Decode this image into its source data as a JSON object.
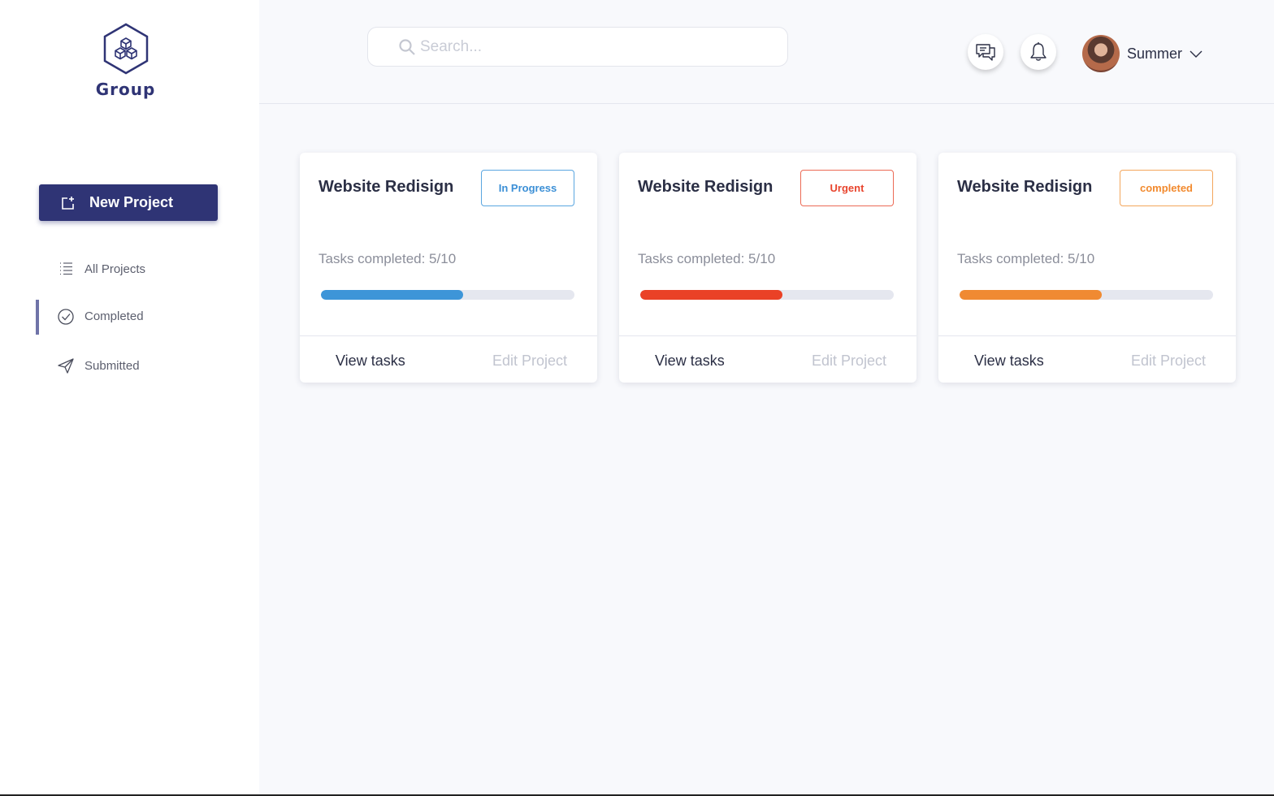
{
  "brand": {
    "name": "Group"
  },
  "sidebar": {
    "new_project_label": "New Project",
    "items": [
      {
        "label": "All Projects",
        "icon": "list-icon",
        "active": false
      },
      {
        "label": "Completed",
        "icon": "check-circle-icon",
        "active": true
      },
      {
        "label": "Submitted",
        "icon": "send-icon",
        "active": false
      }
    ]
  },
  "header": {
    "search_placeholder": "Search...",
    "user_name": "Summer"
  },
  "projects": [
    {
      "title": "Website Redisign",
      "status": "In Progress",
      "status_color": "#3b8fd6",
      "tasks_label": "Tasks completed: 5/10",
      "progress": 0.5,
      "bar_color": "#3d95d8",
      "view_label": "View tasks",
      "edit_label": "Edit Project"
    },
    {
      "title": "Website Redisign",
      "status": "Urgent",
      "status_color": "#e8452e",
      "tasks_label": "Tasks completed: 5/10",
      "progress": 0.5,
      "bar_color": "#ea4126",
      "view_label": "View tasks",
      "edit_label": "Edit Project"
    },
    {
      "title": "Website Redisign",
      "status": "completed",
      "status_color": "#f28a2e",
      "tasks_label": "Tasks completed: 5/10",
      "progress": 0.5,
      "bar_color": "#f08a32",
      "view_label": "View tasks",
      "edit_label": "Edit Project"
    }
  ],
  "colors": {
    "primary": "#2f3475",
    "active_indicator": "#6f73a8"
  }
}
